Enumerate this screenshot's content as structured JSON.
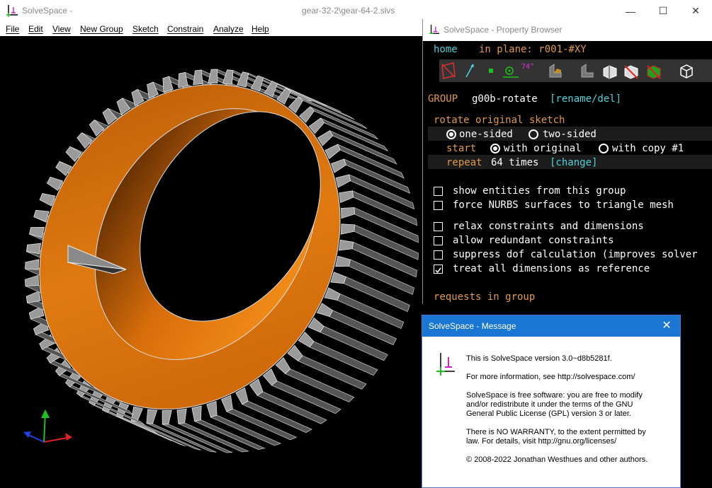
{
  "window": {
    "app_title": "SolveSpace -",
    "file_title": "gear-32-2\\gear-64-2.slvs",
    "minimize": "—",
    "maximize": "☐",
    "close": "✕"
  },
  "menu": [
    "File",
    "Edit",
    "View",
    "New Group",
    "Sketch",
    "Constrain",
    "Analyze",
    "Help"
  ],
  "property_browser": {
    "title": "SolveSpace - Property Browser",
    "nav_home": "home",
    "nav_plane": "in plane: r001-#XY",
    "group_label": "GROUP",
    "group_name": "g00b-rotate",
    "rename_del": "[rename/del]",
    "op_label": "rotate original sketch",
    "one_sided": "one-sided",
    "two_sided": "two-sided",
    "start_label": "start",
    "with_original": "with original",
    "with_copy": "with copy #1",
    "repeat_label": "repeat",
    "repeat_value": "64 times",
    "change_link": "[change]",
    "options": [
      {
        "label": "show entities from this group",
        "checked": false
      },
      {
        "label": "force NURBS surfaces to triangle mesh",
        "checked": false
      },
      {
        "label": "relax constraints and dimensions",
        "checked": false
      },
      {
        "label": "allow redundant constraints",
        "checked": false
      },
      {
        "label": "suppress dof calculation (improves solver",
        "checked": false
      },
      {
        "label": "treat all dimensions as reference",
        "checked": true
      }
    ],
    "requests_label": "requests in group",
    "toolbar_angle": "74°"
  },
  "message": {
    "title": "SolveSpace - Message",
    "close": "✕",
    "line1": "This is SolveSpace version 3.0~d8b5281f.",
    "line2": "For more information, see http://solvespace.com/",
    "line3a": "SolveSpace is free software: you are free to modify",
    "line3b": "and/or redistribute it under the terms of the GNU",
    "line3c": "General Public License (GPL) version 3 or later.",
    "line4a": "There is NO WARRANTY, to the extent permitted by",
    "line4b": "law. For details, visit http://gnu.org/licenses/",
    "line5": "© 2008-2022 Jonathan Westhues and other authors."
  },
  "colors": {
    "accent_orange": "#e07a10",
    "text_cyan": "#4fd1d9",
    "text_orange": "#e09a4a",
    "dialog_title": "#1976d2"
  }
}
